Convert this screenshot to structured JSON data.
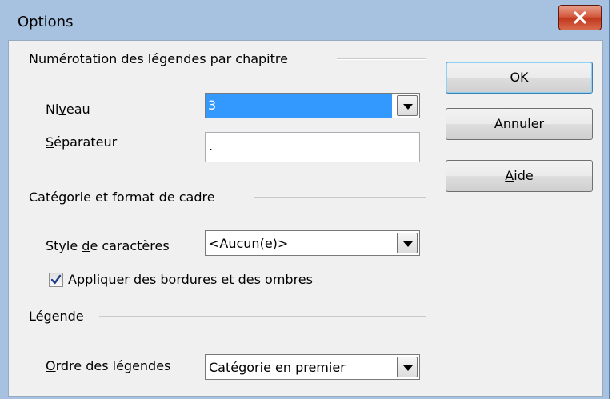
{
  "window": {
    "title": "Options"
  },
  "groups": {
    "numbering": "Numérotation des légendes par chapitre",
    "category": "Catégorie et format de cadre",
    "caption": "Légende"
  },
  "fields": {
    "level": {
      "label_pre": "Ni",
      "label_key": "v",
      "label_post": "eau",
      "value": "3"
    },
    "separator": {
      "label_key": "S",
      "label_post": "éparateur",
      "value": "."
    },
    "char_style": {
      "label_pre": "Style ",
      "label_key": "d",
      "label_post": "e caractères",
      "value": "<Aucun(e)>"
    },
    "apply_borders": {
      "label_key": "A",
      "label_post": "ppliquer des bordures et des ombres",
      "checked": true
    },
    "caption_order": {
      "label_key": "O",
      "label_post": "rdre des légendes",
      "value": "Catégorie en premier"
    }
  },
  "buttons": {
    "ok": "OK",
    "cancel": "Annuler",
    "help_key": "A",
    "help_post": "ide"
  }
}
